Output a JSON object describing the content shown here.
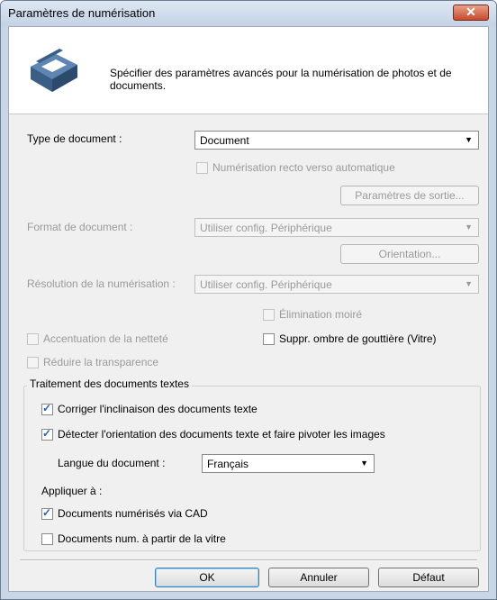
{
  "window": {
    "title": "Paramètres de numérisation",
    "close_icon": "close-icon"
  },
  "header": {
    "description": "Spécifier des paramètres avancés pour la numérisation de photos et de documents."
  },
  "document_type": {
    "label": "Type de document :",
    "value": "Document"
  },
  "duplex": {
    "label": "Numérisation recto verso automatique",
    "checked": false,
    "enabled": false
  },
  "output_settings_button": "Paramètres de sortie...",
  "document_size": {
    "label": "Format de document :",
    "value": "Utiliser config. Périphérique"
  },
  "orientation_button": "Orientation...",
  "resolution": {
    "label": "Résolution de la numérisation :",
    "value": "Utiliser config. Périphérique"
  },
  "descreen": {
    "label": "Élimination moiré",
    "checked": false
  },
  "unsharp_mask": {
    "label": "Accentuation de la netteté",
    "checked": false
  },
  "gutter_shadow": {
    "label": "Suppr. ombre de gouttière (Vitre)",
    "checked": false
  },
  "reduce_show_through": {
    "label": "Réduire la transparence",
    "checked": false
  },
  "text_processing": {
    "title": "Traitement des documents textes",
    "correct_slant": {
      "label": "Corriger l'inclinaison des documents texte",
      "checked": true
    },
    "detect_orientation": {
      "label": "Détecter l'orientation des documents texte et faire pivoter les images",
      "checked": true
    },
    "language": {
      "label": "Langue du document :",
      "value": "Français"
    },
    "apply_to": {
      "label": "Appliquer à :",
      "adf": {
        "label": "Documents numérisés via CAD",
        "checked": true
      },
      "platen": {
        "label": "Documents num. à partir de la vitre",
        "checked": false
      }
    }
  },
  "buttons": {
    "ok": "OK",
    "cancel": "Annuler",
    "default": "Défaut"
  }
}
